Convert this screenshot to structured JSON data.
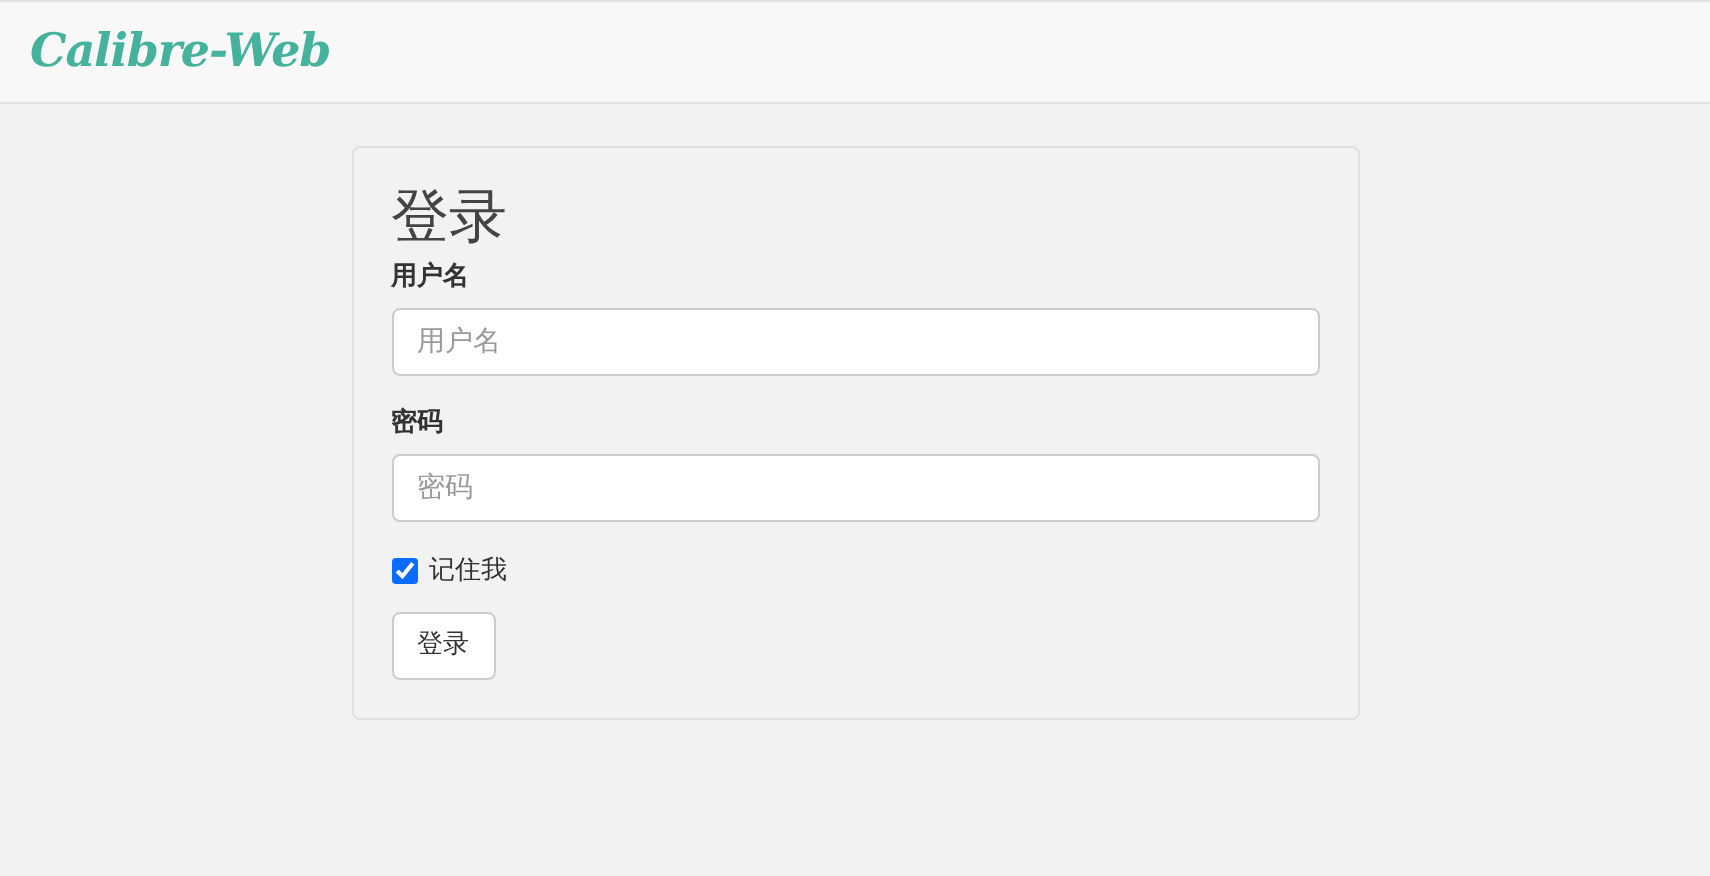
{
  "navbar": {
    "brand": "Calibre-Web"
  },
  "login": {
    "title": "登录",
    "fields": [
      {
        "label": "用户名",
        "placeholder": "用户名"
      },
      {
        "label": "密码",
        "placeholder": "密码"
      }
    ],
    "remember": {
      "label": "记住我",
      "checked": true
    },
    "button": "登录"
  }
}
